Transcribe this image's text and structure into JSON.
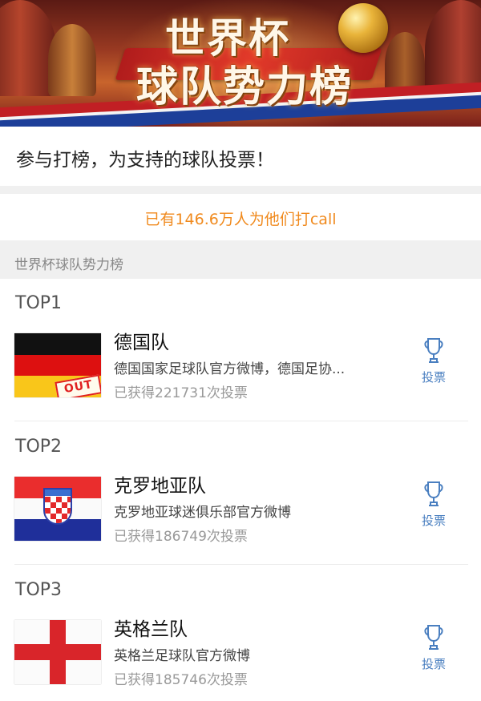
{
  "banner": {
    "title_line1": "世界杯",
    "title_line2": "球队势力榜"
  },
  "intro": {
    "text": "参与打榜，为支持的球队投票！"
  },
  "call": {
    "text": "已有146.6万人为他们打call",
    "color": "#f08a1e"
  },
  "section": {
    "title": "世界杯球队势力榜"
  },
  "rankings": [
    {
      "rank_label": "TOP1",
      "team": "德国队",
      "description": "德国国家足球队官方微博，德国足协...",
      "votes": "已获得221731次投票",
      "vote_label": "投票",
      "flag": "germany-flag",
      "stamp": "OUT"
    },
    {
      "rank_label": "TOP2",
      "team": "克罗地亚队",
      "description": "克罗地亚球迷俱乐部官方微博",
      "votes": "已获得186749次投票",
      "vote_label": "投票",
      "flag": "croatia-flag"
    },
    {
      "rank_label": "TOP3",
      "team": "英格兰队",
      "description": "英格兰足球队官方微博",
      "votes": "已获得185746次投票",
      "vote_label": "投票",
      "flag": "england-flag"
    }
  ],
  "colors": {
    "accent_orange": "#f08a1e",
    "vote_blue": "#4a7fc0",
    "section_bg": "#f0f0f0"
  }
}
